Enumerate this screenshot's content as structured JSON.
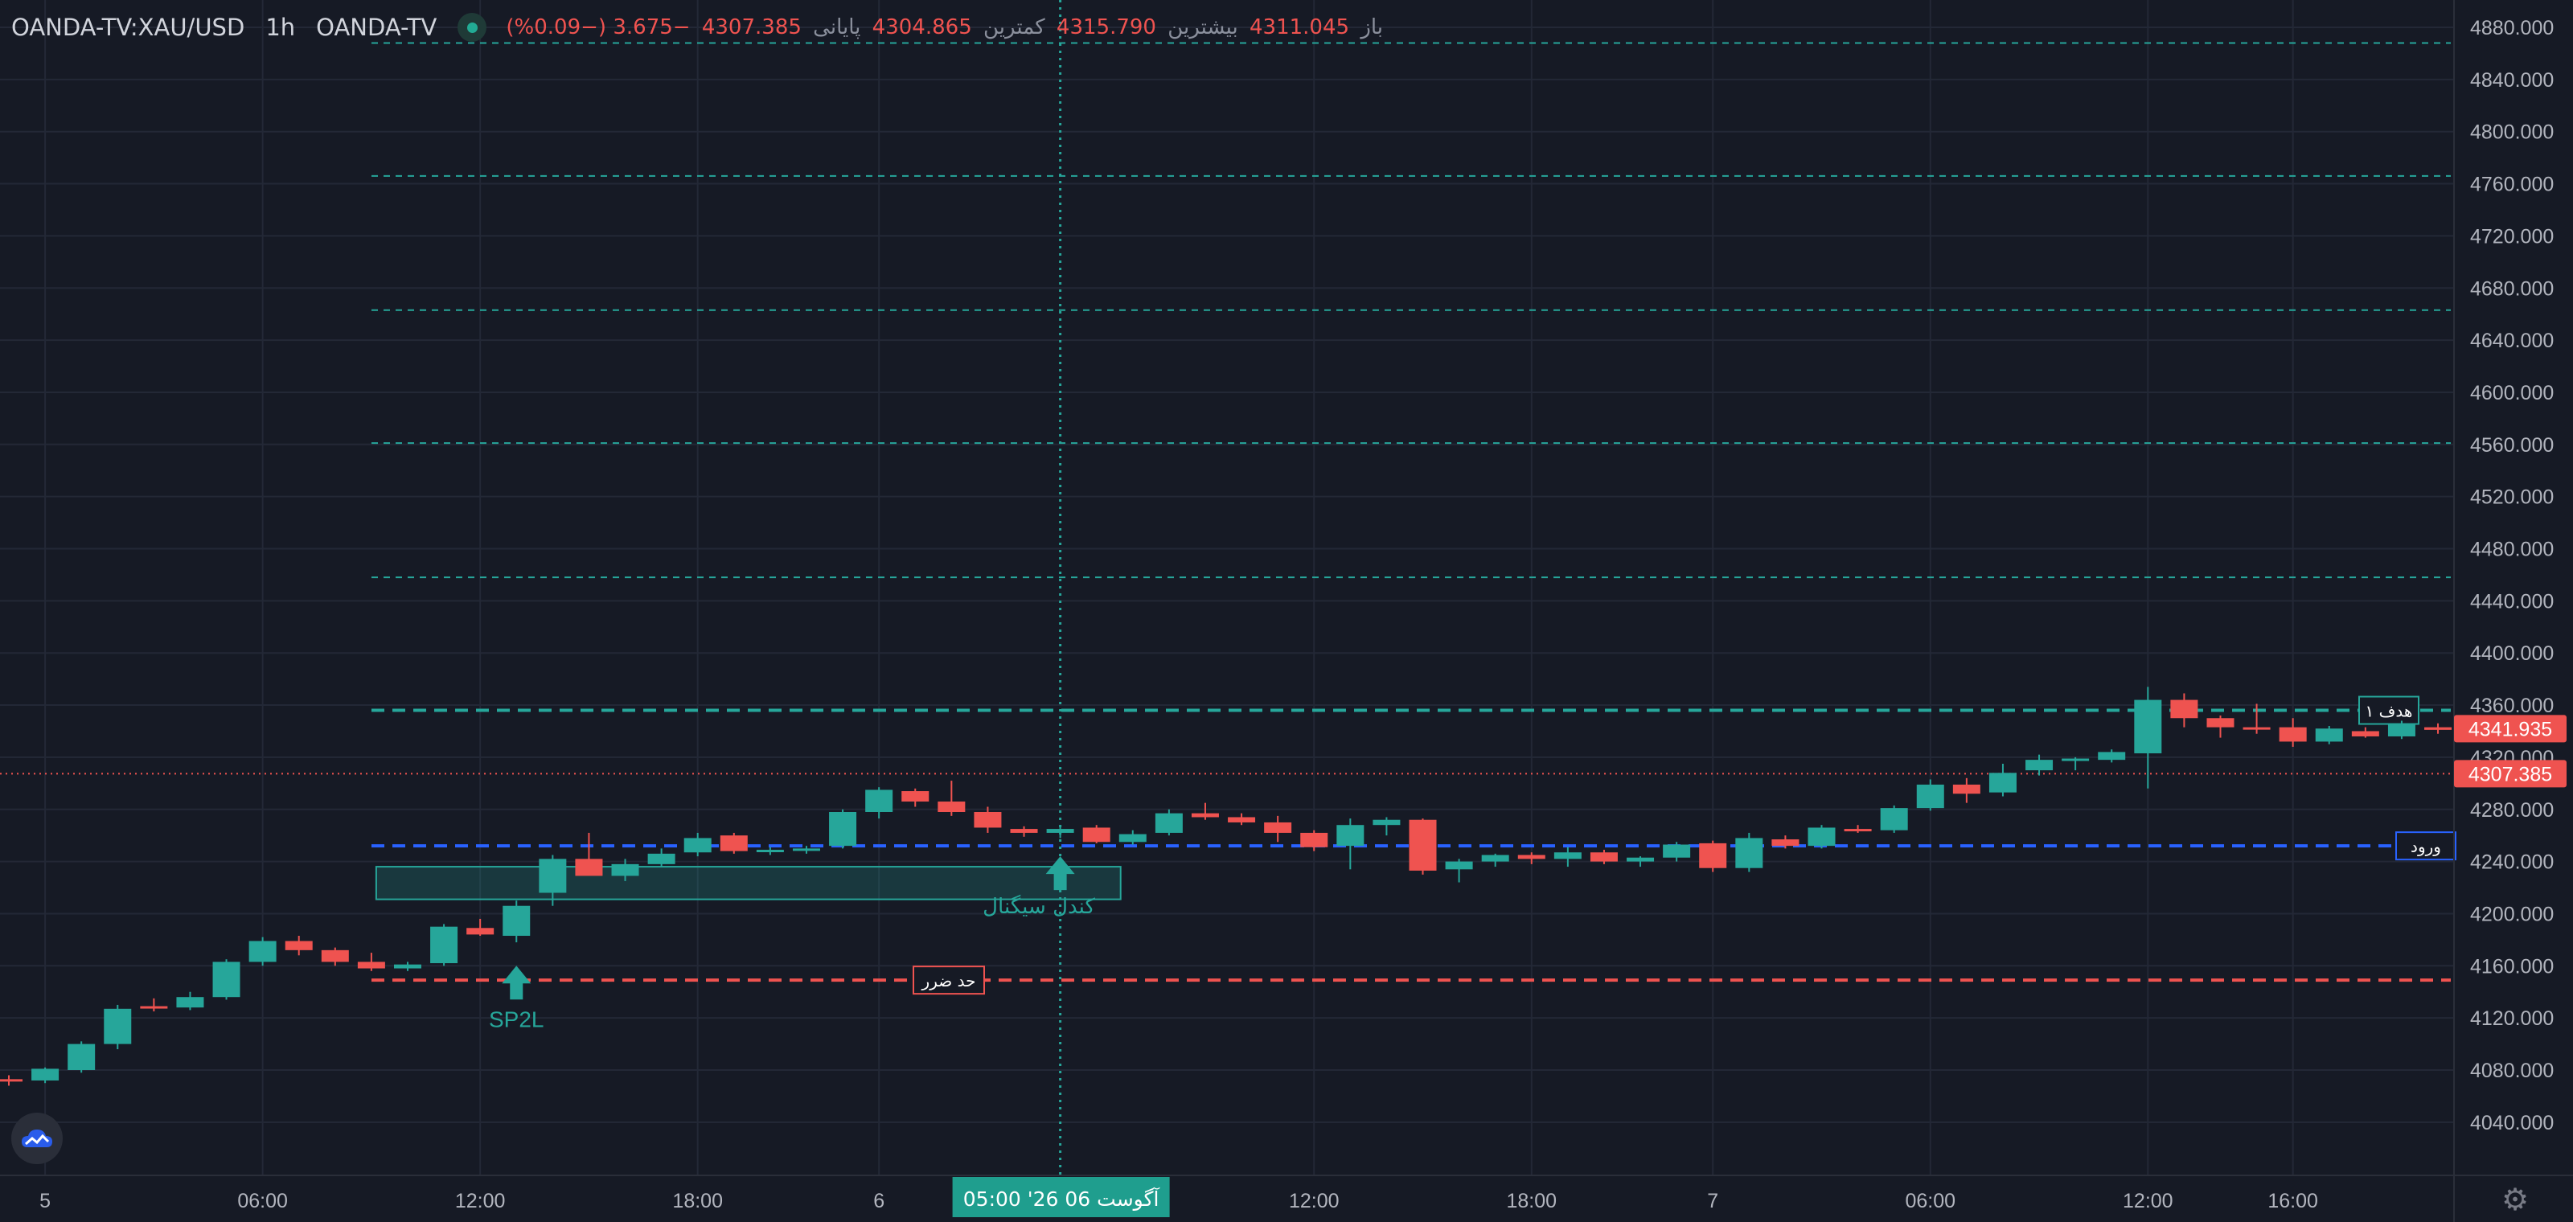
{
  "header": {
    "symbol": "OANDA-TV:XAU/USD",
    "timeframe": "1h",
    "source": "OANDA-TV",
    "open_label": "باز",
    "open": "4311.045",
    "high_label": "بیشترین",
    "high": "4315.790",
    "low_label": "کمترین",
    "low": "4304.865",
    "close_label": "پایانی",
    "close": "4307.385",
    "change": "−3.675 (−0.09%)"
  },
  "colors": {
    "background": "#161a25",
    "up": "#26a69a",
    "down": "#ef5350",
    "target_line": "#26a69a",
    "entry_line": "#2962ff",
    "stop_line": "#ef5350"
  },
  "icons": {
    "logo": "tradingview-cloud-icon",
    "settings": "gear-icon"
  },
  "chart_data": {
    "type": "candlestick",
    "timeframe": "1h",
    "ylim": [
      4010,
      4890
    ],
    "y_ticks": [
      4880,
      4840,
      4800,
      4760,
      4720,
      4680,
      4640,
      4600,
      4560,
      4520,
      4480,
      4440,
      4400,
      4360,
      4320,
      4280,
      4240,
      4200,
      4160,
      4120,
      4080,
      4040
    ],
    "y_tick_labels": [
      "4880.000",
      "4840.000",
      "4800.000",
      "4760.000",
      "4720.000",
      "4680.000",
      "4640.000",
      "4600.000",
      "4560.000",
      "4520.000",
      "4480.000",
      "4440.000",
      "4400.000",
      "4360.000",
      "4320.000",
      "4280.000",
      "4240.000",
      "4200.000",
      "4160.000",
      "4120.000",
      "4080.000",
      "4040.000"
    ],
    "x_ticks": [
      {
        "label": "5",
        "index": 1
      },
      {
        "label": "06:00",
        "index": 7
      },
      {
        "label": "12:00",
        "index": 13
      },
      {
        "label": "18:00",
        "index": 19
      },
      {
        "label": "6",
        "index": 24
      },
      {
        "label": "12:00",
        "index": 36
      },
      {
        "label": "18:00",
        "index": 42
      },
      {
        "label": "7",
        "index": 47
      },
      {
        "label": "06:00",
        "index": 53
      },
      {
        "label": "12:00",
        "index": 59
      },
      {
        "label": "16:00",
        "index": 63
      }
    ],
    "crosshair": {
      "index": 29,
      "label": "05:00  '26 آگوست 06"
    },
    "candles": [
      [
        4073,
        4076,
        4068,
        4072
      ],
      [
        4072,
        4082,
        4070,
        4081
      ],
      [
        4080,
        4102,
        4078,
        4100
      ],
      [
        4100,
        4130,
        4096,
        4127
      ],
      [
        4129,
        4135,
        4125,
        4128
      ],
      [
        4128,
        4140,
        4126,
        4136
      ],
      [
        4136,
        4165,
        4134,
        4163
      ],
      [
        4163,
        4182,
        4160,
        4179
      ],
      [
        4179,
        4183,
        4168,
        4172
      ],
      [
        4172,
        4174,
        4160,
        4163
      ],
      [
        4163,
        4170,
        4156,
        4158
      ],
      [
        4158,
        4163,
        4156,
        4161
      ],
      [
        4162,
        4192,
        4160,
        4190
      ],
      [
        4189,
        4196,
        4183,
        4184
      ],
      [
        4183,
        4210,
        4178,
        4206
      ],
      [
        4216,
        4245,
        4206,
        4242
      ],
      [
        4242,
        4262,
        4231,
        4229
      ],
      [
        4229,
        4242,
        4225,
        4238
      ],
      [
        4238,
        4250,
        4236,
        4246
      ],
      [
        4247,
        4262,
        4244,
        4258
      ],
      [
        4260,
        4262,
        4246,
        4248
      ],
      [
        4248,
        4251,
        4245,
        4249
      ],
      [
        4249,
        4252,
        4246,
        4250
      ],
      [
        4252,
        4280,
        4250,
        4278
      ],
      [
        4278,
        4297,
        4273,
        4295
      ],
      [
        4294,
        4296,
        4282,
        4286
      ],
      [
        4286,
        4302,
        4275,
        4278
      ],
      [
        4278,
        4282,
        4262,
        4266
      ],
      [
        4265,
        4267,
        4259,
        4262
      ],
      [
        4262,
        4268,
        4258,
        4265
      ],
      [
        4266,
        4268,
        4254,
        4255
      ],
      [
        4255,
        4264,
        4253,
        4261
      ],
      [
        4262,
        4280,
        4260,
        4277
      ],
      [
        4277,
        4285,
        4272,
        4274
      ],
      [
        4274,
        4277,
        4268,
        4270
      ],
      [
        4270,
        4275,
        4255,
        4262
      ],
      [
        4262,
        4264,
        4248,
        4251
      ],
      [
        4252,
        4273,
        4234,
        4268
      ],
      [
        4268,
        4274,
        4260,
        4272
      ],
      [
        4272,
        4273,
        4230,
        4233
      ],
      [
        4234,
        4242,
        4224,
        4240
      ],
      [
        4240,
        4246,
        4236,
        4245
      ],
      [
        4245,
        4247,
        4238,
        4242
      ],
      [
        4242,
        4251,
        4236,
        4247
      ],
      [
        4247,
        4249,
        4238,
        4240
      ],
      [
        4240,
        4244,
        4236,
        4243
      ],
      [
        4243,
        4255,
        4240,
        4253
      ],
      [
        4254,
        4256,
        4232,
        4235
      ],
      [
        4235,
        4262,
        4232,
        4258
      ],
      [
        4257,
        4260,
        4250,
        4252
      ],
      [
        4252,
        4268,
        4250,
        4266
      ],
      [
        4265,
        4268,
        4262,
        4264
      ],
      [
        4264,
        4283,
        4262,
        4281
      ],
      [
        4281,
        4303,
        4279,
        4299
      ],
      [
        4299,
        4304,
        4285,
        4292
      ],
      [
        4293,
        4315,
        4290,
        4308
      ],
      [
        4310,
        4322,
        4306,
        4318
      ],
      [
        4318,
        4320,
        4310,
        4319
      ],
      [
        4318,
        4326,
        4316,
        4324
      ],
      [
        4323,
        4374,
        4296,
        4364
      ],
      [
        4364,
        4369,
        4343,
        4350
      ],
      [
        4350,
        4352,
        4335,
        4343
      ],
      [
        4343,
        4361,
        4338,
        4342
      ],
      [
        4343,
        4350,
        4328,
        4332
      ],
      [
        4332,
        4344,
        4330,
        4342
      ],
      [
        4340,
        4343,
        4335,
        4336
      ],
      [
        4336,
        4348,
        4334,
        4345
      ],
      [
        4343,
        4346,
        4338,
        4341
      ]
    ],
    "levels": [
      {
        "price": 4868,
        "style": "dotted",
        "color": "#26a69a"
      },
      {
        "price": 4766,
        "style": "dotted",
        "color": "#26a69a"
      },
      {
        "price": 4663,
        "style": "dotted",
        "color": "#26a69a"
      },
      {
        "price": 4561,
        "style": "dotted",
        "color": "#26a69a"
      },
      {
        "price": 4458,
        "style": "dotted",
        "color": "#26a69a"
      },
      {
        "price": 4356,
        "style": "dashed",
        "color": "#26a69a",
        "label": "هدف ۱"
      },
      {
        "price": 4252,
        "style": "dashed",
        "color": "#2962ff",
        "label": "ورود"
      },
      {
        "price": 4149,
        "style": "dashed",
        "color": "#ef5350",
        "label": "حد ضرر"
      }
    ],
    "current_price_line": 4307.385,
    "price_labels": [
      {
        "price": 4341.935,
        "label": "4341.935"
      },
      {
        "price": 4307.385,
        "label": "4307.385"
      }
    ],
    "signal_zone": {
      "from_index": 10,
      "to_index": 30,
      "top": 4236,
      "bottom": 4211,
      "label": "کندل سیگنال"
    },
    "markers": [
      {
        "index": 14,
        "price": 4160,
        "label": "SP2L"
      },
      {
        "index": 29,
        "price": 4244,
        "label": ""
      }
    ]
  }
}
